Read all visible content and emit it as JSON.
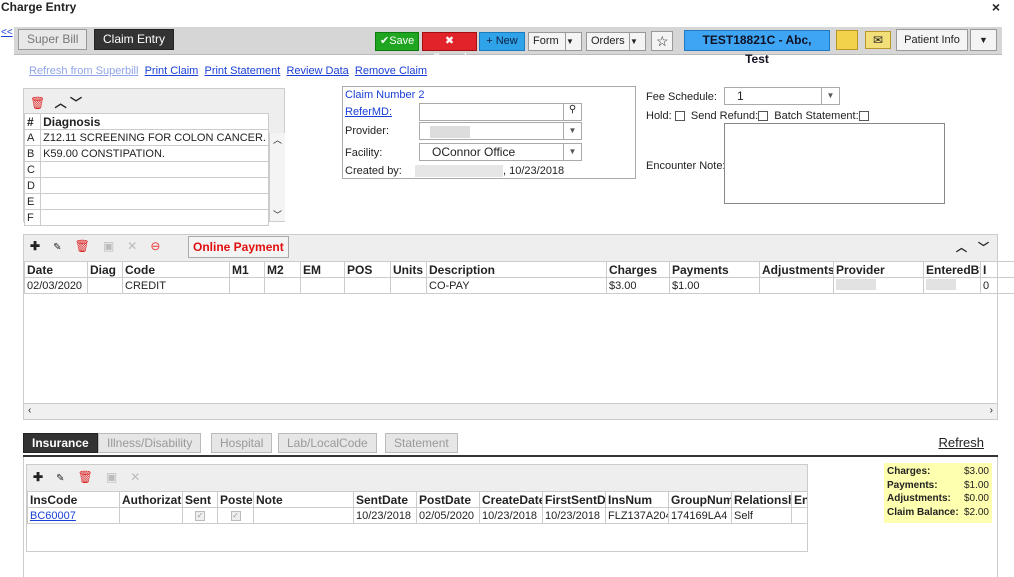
{
  "window": {
    "title": "Charge Entry",
    "close": "×"
  },
  "nav": {
    "back": "<<",
    "tab_superbill": "Super Bill",
    "tab_claim": "Claim Entry"
  },
  "toolbar": {
    "save": "Save",
    "cancel": "Cancel",
    "new": "+ New",
    "form": "Form",
    "orders": "Orders",
    "patient": "TEST18821C - Abc, Test",
    "patient_info": "Patient Info"
  },
  "links": {
    "refresh_superbill": "Refresh from Superbill",
    "print_claim": "Print Claim",
    "print_statement": "Print Statement",
    "review_data": "Review Data",
    "remove_claim": "Remove Claim"
  },
  "diagnosis": {
    "header_num": "#",
    "header_diag": "Diagnosis",
    "rows": [
      {
        "l": "A",
        "v": "Z12.11 SCREENING FOR COLON CANCER."
      },
      {
        "l": "B",
        "v": "K59.00 CONSTIPATION."
      },
      {
        "l": "C",
        "v": ""
      },
      {
        "l": "D",
        "v": ""
      },
      {
        "l": "E",
        "v": ""
      },
      {
        "l": "F",
        "v": ""
      }
    ]
  },
  "claim": {
    "number": "Claim Number 2",
    "refer_label": "ReferMD:",
    "provider_label": "Provider:",
    "facility_label": "Facility:",
    "facility_value": "OConnor Office",
    "created_label": "Created by:",
    "created_date": ", 10/23/2018"
  },
  "fee": {
    "label": "Fee Schedule:",
    "value": "1",
    "hold": "Hold:",
    "refund": "Send Refund:",
    "batch": "Batch Statement:",
    "encounter": "Encounter Note:"
  },
  "charges": {
    "online_payment": "Online Payment",
    "columns": [
      "Date",
      "Diag",
      "Code",
      "M1",
      "M2",
      "EM",
      "POS",
      "Units",
      "Description",
      "Charges",
      "Payments",
      "Adjustments",
      "Provider",
      "EnteredBy",
      "I"
    ],
    "rows": [
      [
        "02/03/2020",
        "",
        "CREDIT",
        "",
        "",
        "",
        "",
        "",
        "CO-PAY",
        "$3.00",
        "$1.00",
        "",
        "",
        "",
        "0"
      ]
    ]
  },
  "bottom_tabs": {
    "insurance": "Insurance",
    "illness": "Illness/Disability",
    "hospital": "Hospital",
    "lab": "Lab/LocalCode",
    "statement": "Statement",
    "refresh": "Refresh"
  },
  "insurance": {
    "columns": [
      "InsCode",
      "Authorizat",
      "Sent",
      "Postec",
      "Note",
      "SentDate",
      "PostDate",
      "CreateDate",
      "FirstSentDa",
      "InsNum",
      "GroupNum",
      "Relationshi",
      "En"
    ],
    "rows": [
      [
        "BC60007",
        "",
        "",
        "",
        "",
        "10/23/2018",
        "02/05/2020",
        "10/23/2018",
        "10/23/2018",
        "FLZ137A204",
        "174169LA4",
        "Self",
        ""
      ]
    ]
  },
  "summary": {
    "charges_label": "Charges:",
    "charges": "$3.00",
    "payments_label": "Payments:",
    "payments": "$1.00",
    "adjustments_label": "Adjustments:",
    "adjustments": "$0.00",
    "balance_label": "Claim Balance:",
    "balance": "$2.00"
  },
  "colors": {
    "save": "#1fa51f",
    "cancel": "#e0242a",
    "new": "#2ea3ea",
    "patient": "#3da5f4",
    "dark_tab": "#333333",
    "summary_bg": "#ffffb0"
  }
}
